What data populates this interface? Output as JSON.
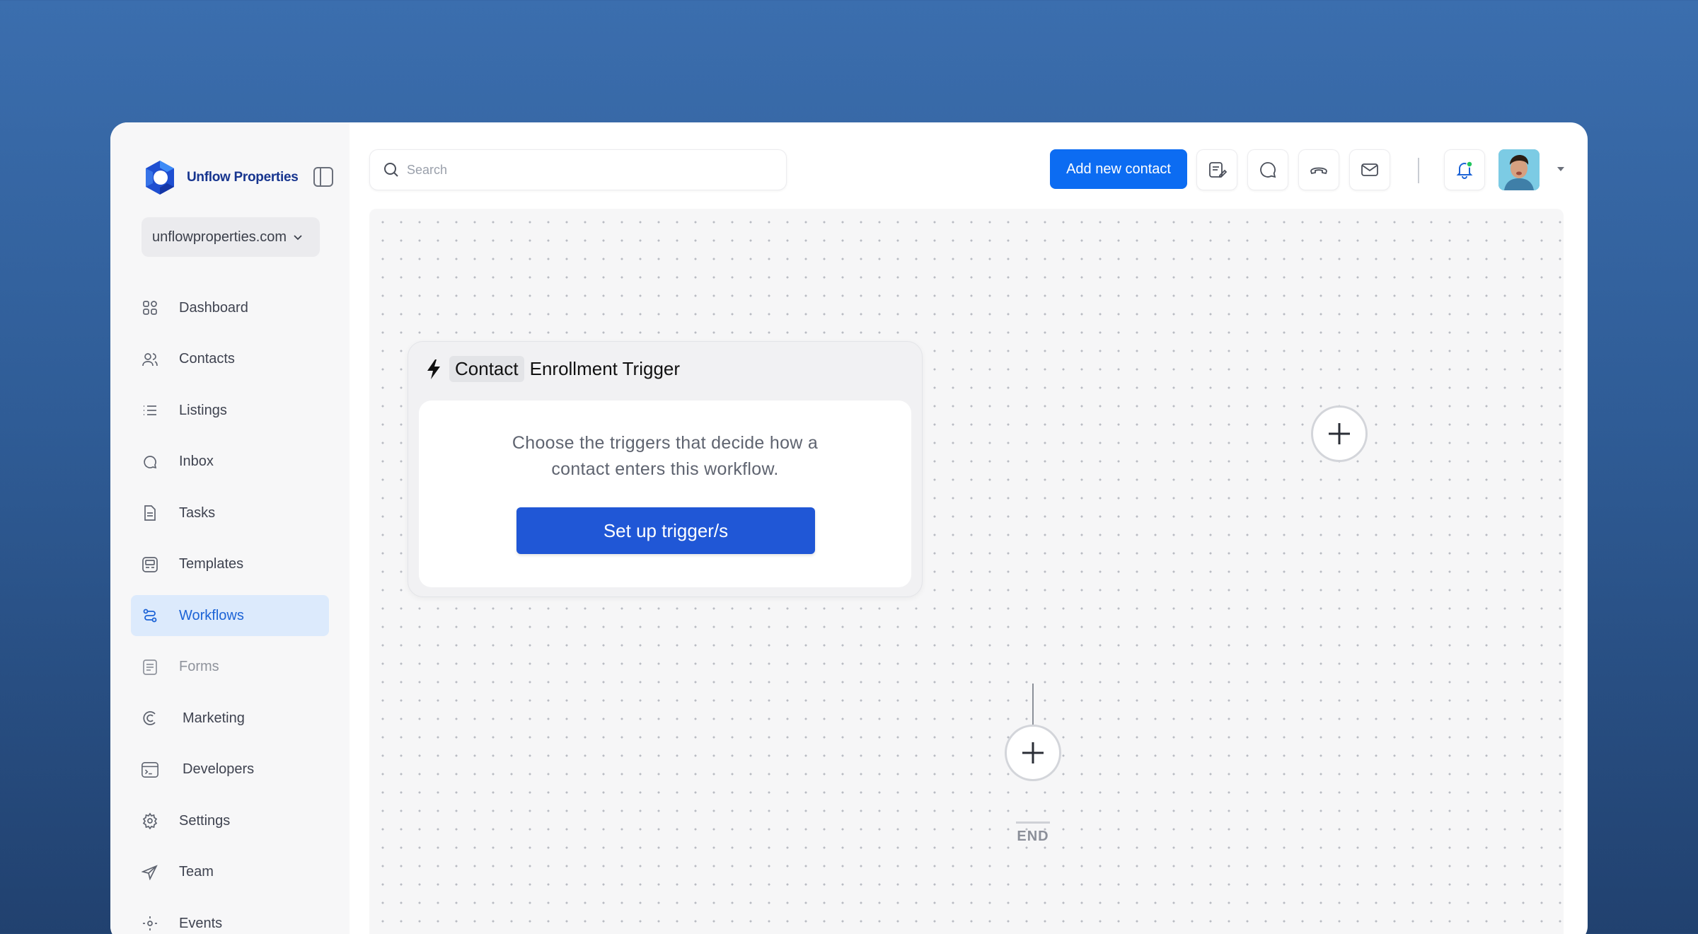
{
  "brand": {
    "name": "Unflow Properties",
    "accent": "#0c6cf2"
  },
  "domain_select": {
    "value": "unflowproperties.com"
  },
  "sidebar": {
    "items": [
      {
        "label": "Dashboard",
        "icon": "grid-icon"
      },
      {
        "label": "Contacts",
        "icon": "users-icon"
      },
      {
        "label": "Listings",
        "icon": "list-icon"
      },
      {
        "label": "Inbox",
        "icon": "chat-bubble-icon"
      },
      {
        "label": "Tasks",
        "icon": "document-icon"
      },
      {
        "label": "Templates",
        "icon": "template-icon"
      },
      {
        "label": "Workflows",
        "icon": "workflow-icon",
        "active": true
      },
      {
        "label": "Forms",
        "icon": "form-icon"
      },
      {
        "label": "Marketing",
        "icon": "marketing-icon"
      },
      {
        "label": "Developers",
        "icon": "terminal-icon"
      },
      {
        "label": "Settings",
        "icon": "gear-icon"
      },
      {
        "label": "Team",
        "icon": "send-icon"
      },
      {
        "label": "Events",
        "icon": "sun-icon"
      }
    ]
  },
  "topbar": {
    "search_placeholder": "Search",
    "add_contact_label": "Add new contact",
    "tools": [
      "notes-icon",
      "chat-icon",
      "phone-icon",
      "mail-icon"
    ],
    "notification_dot_color": "#22c55e"
  },
  "workflow": {
    "trigger_chip": "Contact",
    "trigger_title": "Enrollment Trigger",
    "trigger_description": "Choose the triggers that decide how a contact enters this workflow.",
    "setup_button": "Set up trigger/s",
    "end_label": "END"
  }
}
